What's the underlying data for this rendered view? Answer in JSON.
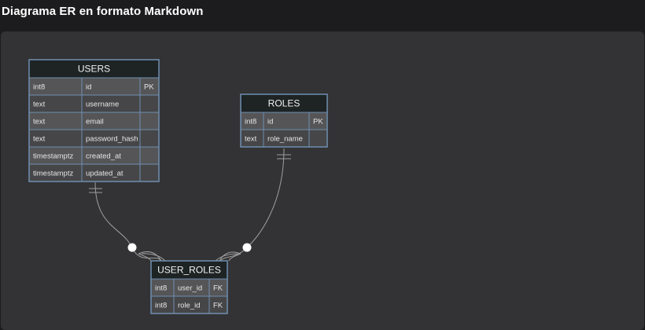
{
  "page": {
    "title": "Diagrama ER en formato Markdown"
  },
  "colors": {
    "header_bg": "#1e2324",
    "row_dark": "#555557",
    "row_light": "#464648",
    "border": "#6f8fb0",
    "line": "#9e9e9e"
  },
  "tables": [
    {
      "name": "USERS",
      "columns": [
        {
          "type": "int8",
          "name": "id",
          "key": "PK"
        },
        {
          "type": "text",
          "name": "username",
          "key": ""
        },
        {
          "type": "text",
          "name": "email",
          "key": ""
        },
        {
          "type": "text",
          "name": "password_hash",
          "key": ""
        },
        {
          "type": "timestamptz",
          "name": "created_at",
          "key": ""
        },
        {
          "type": "timestamptz",
          "name": "updated_at",
          "key": ""
        }
      ]
    },
    {
      "name": "ROLES",
      "columns": [
        {
          "type": "int8",
          "name": "id",
          "key": "PK"
        },
        {
          "type": "text",
          "name": "role_name",
          "key": ""
        }
      ]
    },
    {
      "name": "USER_ROLES",
      "columns": [
        {
          "type": "int8",
          "name": "user_id",
          "key": "FK"
        },
        {
          "type": "int8",
          "name": "role_id",
          "key": "FK"
        }
      ]
    }
  ],
  "relationships": [
    {
      "from": "USERS",
      "to": "USER_ROLES",
      "from_cardinality": "exactly-one",
      "to_cardinality": "zero-or-many"
    },
    {
      "from": "ROLES",
      "to": "USER_ROLES",
      "from_cardinality": "exactly-one",
      "to_cardinality": "zero-or-many"
    }
  ]
}
